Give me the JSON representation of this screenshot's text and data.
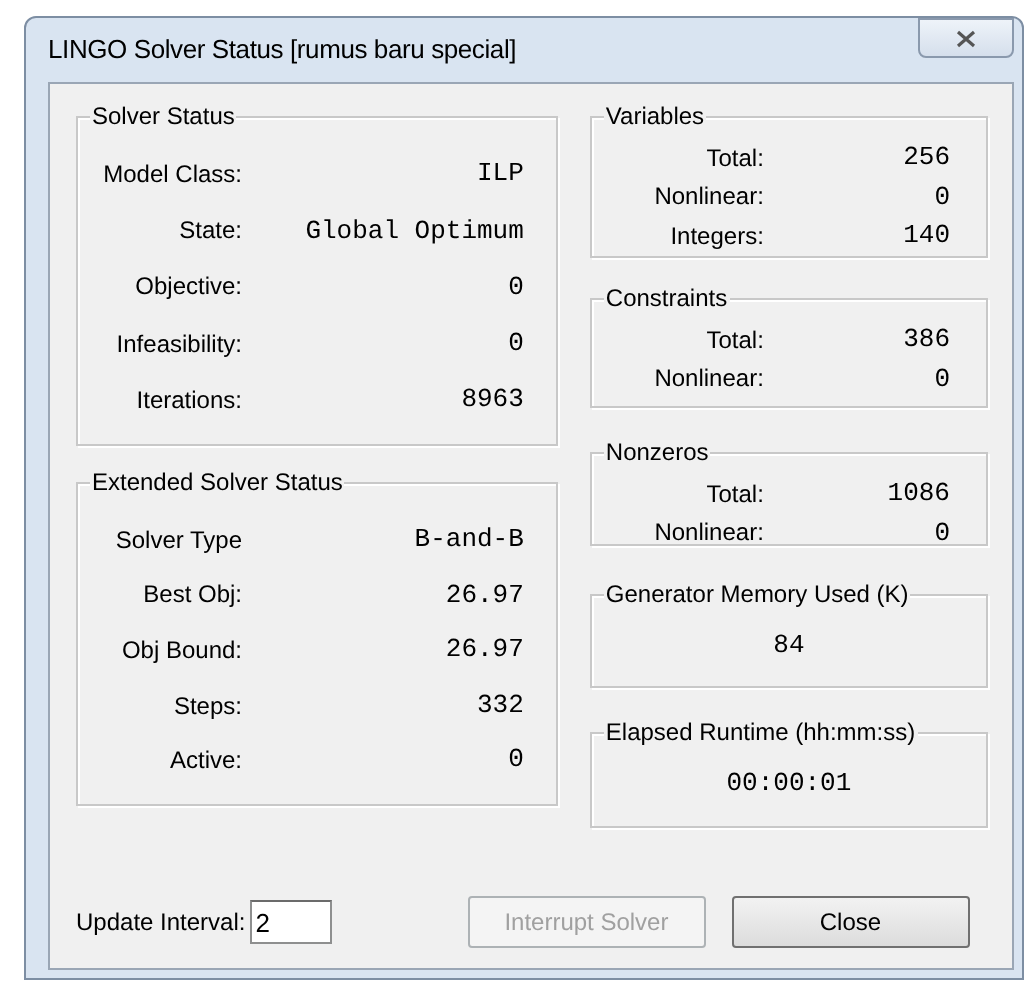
{
  "window": {
    "title": "LINGO Solver Status [rumus baru special]"
  },
  "left_groups": [
    {
      "kind": "rows",
      "title": "Solver Status",
      "rows": [
        {
          "label": "Model Class:",
          "value": "ILP"
        },
        {
          "label": "State:",
          "value": "Global Optimum"
        },
        {
          "label": "Objective:",
          "value": "0"
        },
        {
          "label": "Infeasibility:",
          "value": "0"
        },
        {
          "label": "Iterations:",
          "value": "8963"
        }
      ]
    },
    {
      "kind": "rows",
      "title": "Extended Solver Status",
      "rows": [
        {
          "label": "Solver Type",
          "value": "B-and-B"
        },
        {
          "label": "Best Obj:",
          "value": "26.97"
        },
        {
          "label": "Obj Bound:",
          "value": "26.97"
        },
        {
          "label": "Steps:",
          "value": "332"
        },
        {
          "label": "Active:",
          "value": "0"
        }
      ]
    }
  ],
  "right_groups": [
    {
      "kind": "rows",
      "title": "Variables",
      "rows": [
        {
          "label": "Total:",
          "value": "256"
        },
        {
          "label": "Nonlinear:",
          "value": "0"
        },
        {
          "label": "Integers:",
          "value": "140"
        }
      ]
    },
    {
      "kind": "rows",
      "title": "Constraints",
      "rows": [
        {
          "label": "Total:",
          "value": "386"
        },
        {
          "label": "Nonlinear:",
          "value": "0"
        }
      ]
    },
    {
      "kind": "rows",
      "title": "Nonzeros",
      "rows": [
        {
          "label": "Total:",
          "value": "1086"
        },
        {
          "label": "Nonlinear:",
          "value": "0"
        }
      ]
    },
    {
      "kind": "single",
      "title": "Generator Memory Used (K)",
      "value": "84"
    },
    {
      "kind": "single",
      "title": "Elapsed Runtime (hh:mm:ss)",
      "value": "00:00:01"
    }
  ],
  "update_interval": {
    "label": "Update Interval:",
    "value": "2"
  },
  "buttons": [
    {
      "label": "Interrupt Solver",
      "disabled": true
    },
    {
      "label": "Close",
      "disabled": false
    }
  ]
}
